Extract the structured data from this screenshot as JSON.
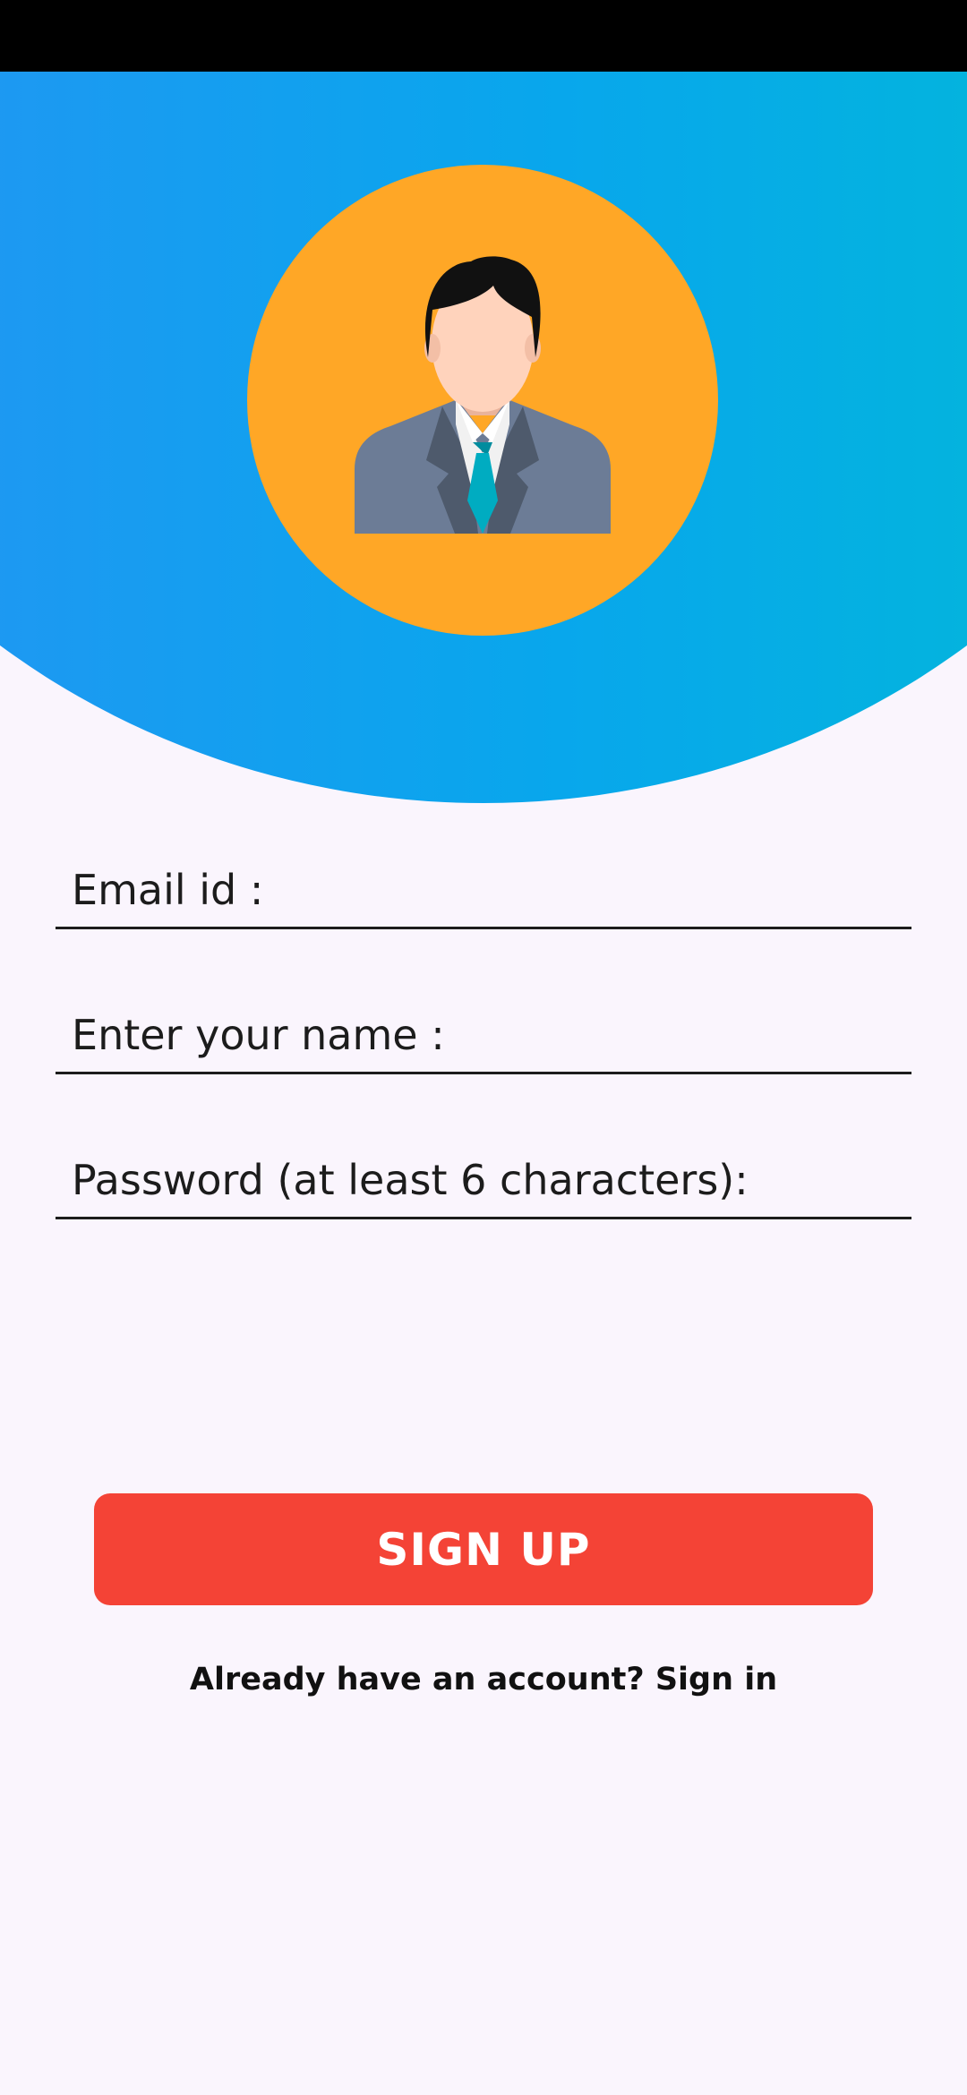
{
  "colors": {
    "background": "#FAF5FD",
    "status_bar": "#000000",
    "header_gradient_start": "#2196F3",
    "header_gradient_end": "#00BCD4",
    "avatar_background": "#FFA726",
    "signup_button": "#F44336",
    "text": "#1C1C1C"
  },
  "form": {
    "email_placeholder": "Email id :",
    "name_placeholder": "Enter your name :",
    "password_placeholder": "Password (at least 6 characters):"
  },
  "actions": {
    "signup_label": "SIGN UP",
    "signin_link": "Already have an account? Sign in"
  },
  "icons": {
    "avatar": "businessman-avatar-icon"
  }
}
